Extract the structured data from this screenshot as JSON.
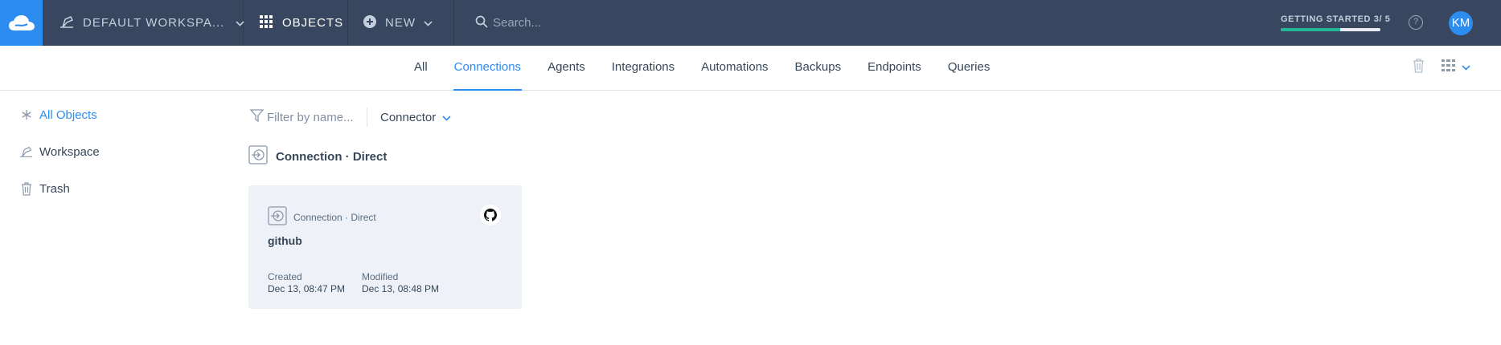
{
  "topbar": {
    "workspace_label": "DEFAULT WORKSPA...",
    "objects_label": "OBJECTS",
    "new_label": "NEW",
    "search_placeholder": "Search...",
    "getting_started": {
      "label": "GETTING STARTED 3/ 5",
      "progress": 0.6
    },
    "help_label": "?",
    "avatar_initials": "KM"
  },
  "tabs": [
    {
      "label": "All",
      "active": false
    },
    {
      "label": "Connections",
      "active": true
    },
    {
      "label": "Agents",
      "active": false
    },
    {
      "label": "Integrations",
      "active": false
    },
    {
      "label": "Automations",
      "active": false
    },
    {
      "label": "Backups",
      "active": false
    },
    {
      "label": "Endpoints",
      "active": false
    },
    {
      "label": "Queries",
      "active": false
    }
  ],
  "toolbar_icons": [
    "trash-icon",
    "grid-view-icon",
    "chevron-down-icon"
  ],
  "sidebar": {
    "items": [
      {
        "label": "All Objects",
        "icon": "asterisk-icon",
        "active": true
      },
      {
        "label": "Workspace",
        "icon": "workspace-icon",
        "active": false
      },
      {
        "label": "Trash",
        "icon": "trash-icon",
        "active": false
      }
    ]
  },
  "filter": {
    "placeholder": "Filter by name...",
    "connector_label": "Connector"
  },
  "group": {
    "title": "Connection · Direct"
  },
  "cards": [
    {
      "type_label": "Connection · Direct",
      "name": "github",
      "icon": "github-icon",
      "created_label": "Created",
      "created_value": "Dec 13, 08:47 PM",
      "modified_label": "Modified",
      "modified_value": "Dec 13, 08:48 PM"
    }
  ],
  "colors": {
    "topbar_bg": "#38475f",
    "accent": "#2d8cf0",
    "progress": "#25b69a",
    "card_bg": "#eef2f8"
  }
}
